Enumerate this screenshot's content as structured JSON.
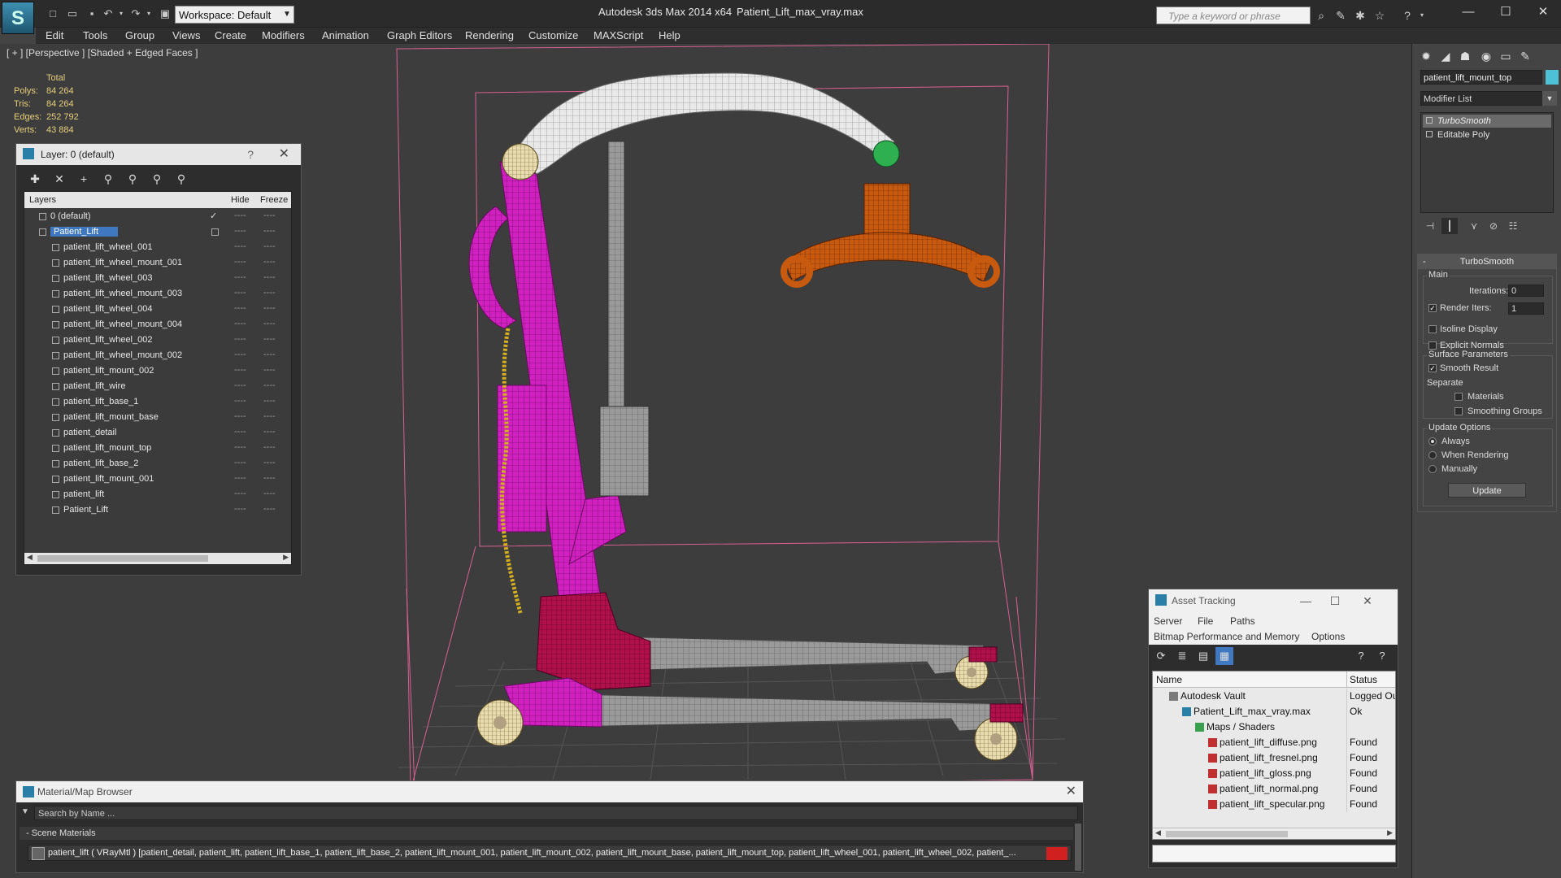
{
  "titlebar": {
    "app_title": "Autodesk 3ds Max  2014 x64",
    "file_title": "Patient_Lift_max_vray.max",
    "workspace": "Workspace: Default",
    "search_placeholder": "Type a keyword or phrase"
  },
  "menu": [
    "Edit",
    "Tools",
    "Group",
    "Views",
    "Create",
    "Modifiers",
    "Animation",
    "Graph Editors",
    "Rendering",
    "Customize",
    "MAXScript",
    "Help"
  ],
  "viewport": {
    "label": "[ + ] [Perspective ] [Shaded + Edged Faces ]",
    "stats": {
      "header": "Total",
      "polys_label": "Polys:",
      "polys": "84 264",
      "tris_label": "Tris:",
      "tris": "84 264",
      "edges_label": "Edges:",
      "edges": "252 792",
      "verts_label": "Verts:",
      "verts": "43 884"
    }
  },
  "layer_dialog": {
    "title": "Layer: 0 (default)",
    "help": "?",
    "columns": {
      "layers": "Layers",
      "hide": "Hide",
      "freeze": "Freeze"
    },
    "rows": [
      {
        "name": "0 (default)",
        "level": 0,
        "checked": true
      },
      {
        "name": "Patient_Lift",
        "level": 0,
        "selected": true
      },
      {
        "name": "patient_lift_wheel_001",
        "level": 1
      },
      {
        "name": "patient_lift_wheel_mount_001",
        "level": 1
      },
      {
        "name": "patient_lift_wheel_003",
        "level": 1
      },
      {
        "name": "patient_lift_wheel_mount_003",
        "level": 1
      },
      {
        "name": "patient_lift_wheel_004",
        "level": 1
      },
      {
        "name": "patient_lift_wheel_mount_004",
        "level": 1
      },
      {
        "name": "patient_lift_wheel_002",
        "level": 1
      },
      {
        "name": "patient_lift_wheel_mount_002",
        "level": 1
      },
      {
        "name": "patient_lift_mount_002",
        "level": 1
      },
      {
        "name": "patient_lift_wire",
        "level": 1
      },
      {
        "name": "patient_lift_base_1",
        "level": 1
      },
      {
        "name": "patient_lift_mount_base",
        "level": 1
      },
      {
        "name": "patient_detail",
        "level": 1
      },
      {
        "name": "patient_lift_mount_top",
        "level": 1
      },
      {
        "name": "patient_lift_base_2",
        "level": 1
      },
      {
        "name": "patient_lift_mount_001",
        "level": 1
      },
      {
        "name": "patient_lift",
        "level": 1
      },
      {
        "name": "Patient_Lift",
        "level": 1
      }
    ]
  },
  "command_panel": {
    "object_name": "patient_lift_mount_top",
    "object_color": "#4fc1d6",
    "modifier_list": "Modifier List",
    "stack": [
      "TurboSmooth",
      "Editable Poly"
    ],
    "rollout_title": "TurboSmooth",
    "main_group": "Main",
    "iterations_label": "Iterations:",
    "iterations": "0",
    "render_iters_label": "Render Iters:",
    "render_iters": "1",
    "isoline_display": "Isoline Display",
    "explicit_normals": "Explicit Normals",
    "surface_group": "Surface Parameters",
    "smooth_result": "Smooth Result",
    "separate_label": "Separate",
    "materials": "Materials",
    "smoothing_groups": "Smoothing Groups",
    "update_group": "Update Options",
    "always": "Always",
    "when_rendering": "When Rendering",
    "manually": "Manually",
    "update_button": "Update"
  },
  "asset_tracking": {
    "title": "Asset Tracking",
    "menu": {
      "server": "Server",
      "file": "File",
      "paths": "Paths",
      "bitmap": "Bitmap Performance and Memory",
      "options": "Options"
    },
    "columns": {
      "name": "Name",
      "status": "Status"
    },
    "rows": [
      {
        "name": "Autodesk Vault",
        "level": 1,
        "status": "Logged Out",
        "icon": "vault-icon"
      },
      {
        "name": "Patient_Lift_max_vray.max",
        "level": 2,
        "status": "Ok",
        "icon": "max-file-icon"
      },
      {
        "name": "Maps / Shaders",
        "level": 3,
        "status": "",
        "icon": "maps-icon"
      },
      {
        "name": "patient_lift_diffuse.png",
        "level": 4,
        "status": "Found",
        "icon": "png-icon"
      },
      {
        "name": "patient_lift_fresnel.png",
        "level": 4,
        "status": "Found",
        "icon": "png-icon"
      },
      {
        "name": "patient_lift_gloss.png",
        "level": 4,
        "status": "Found",
        "icon": "png-icon"
      },
      {
        "name": "patient_lift_normal.png",
        "level": 4,
        "status": "Found",
        "icon": "png-icon"
      },
      {
        "name": "patient_lift_specular.png",
        "level": 4,
        "status": "Found",
        "icon": "png-icon"
      }
    ]
  },
  "material_browser": {
    "title": "Material/Map Browser",
    "search_placeholder": "Search by Name ...",
    "group": "- Scene Materials",
    "entry": "patient_lift ( VRayMtl ) [patient_detail, patient_lift, patient_lift_base_1, patient_lift_base_2, patient_lift_mount_001, patient_lift_mount_002, patient_lift_mount_base, patient_lift_mount_top, patient_lift_wheel_001, patient_lift_wheel_002, patient_..."
  },
  "colors": {
    "accent_blue": "#3f78c0",
    "stats_text": "#e6d07a",
    "object_magenta": "#d020c0",
    "object_crimson": "#b0104a",
    "object_orange": "#c85a10",
    "object_cream": "#e8dcae",
    "object_white": "#e8e8e8",
    "object_grey": "#9a9a9a",
    "bbox_pink": "#d86090"
  }
}
